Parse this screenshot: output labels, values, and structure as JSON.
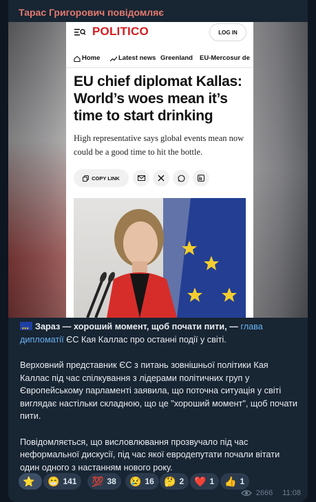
{
  "sender": {
    "name": "Тарас Григорович повідомляє",
    "color": "#e27a6f"
  },
  "article": {
    "logo": "POLITICO",
    "login_label": "LOG IN",
    "nav": [
      "Home",
      "Latest news",
      "Greenland",
      "EU-Mercosur de"
    ],
    "headline": "EU chief diplomat Kallas: World’s woes mean it’s time to start drinking",
    "dek": "High representative says global events mean now could be a good time to hit the bottle.",
    "copy_link_label": "COPY LINK",
    "share_icons": [
      "mail-icon",
      "x-icon",
      "whatsapp-icon",
      "linkedin-icon"
    ]
  },
  "caption": {
    "p1_bold": "Зараз — хороший момент, щоб почати пити, —",
    "p1_link": "глава дипломатії",
    "p1_rest": "ЄС Кая Каллас про останні події у світі.",
    "p2": "Верховний представник ЄС з питань зовнішньої політики Кая Каллас під час спілкування з лідерами політичних груп у Європейському парламенті заявила, що поточна ситуація у світі виглядає настільки складною, що це \"хороший момент\", щоб почати пити.",
    "p3": "Повідомляється, що висловлювання прозвучало під час неформальної дискусії, під час якої евродепутати почали вітати один одного з настанням нового року."
  },
  "reactions": [
    {
      "emoji": "⭐",
      "count": ""
    },
    {
      "emoji": "😁",
      "count": "141"
    },
    {
      "emoji": "💯",
      "count": "38"
    },
    {
      "emoji": "😢",
      "count": "16"
    },
    {
      "emoji": "🤔",
      "count": "2"
    },
    {
      "emoji": "❤️",
      "count": "1"
    },
    {
      "emoji": "👍",
      "count": "1"
    }
  ],
  "meta": {
    "views": "2666",
    "time": "11:08"
  },
  "colors": {
    "bubble": "#182533",
    "background": "#0e1621",
    "link": "#6ab3f3",
    "politico_red": "#d51c1f"
  }
}
